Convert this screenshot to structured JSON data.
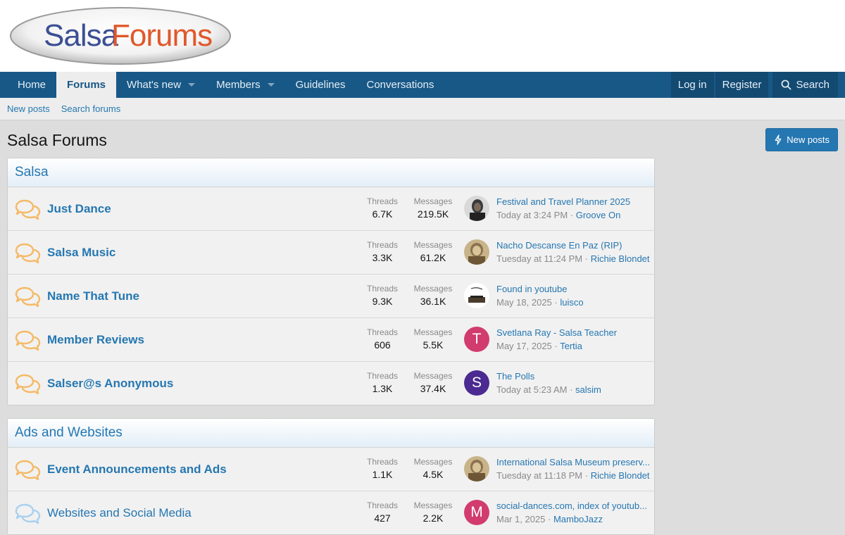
{
  "logo": {
    "part1": "Salsa",
    "part2": "Forums"
  },
  "nav": {
    "home": "Home",
    "forums": "Forums",
    "whats_new": "What's new",
    "members": "Members",
    "guidelines": "Guidelines",
    "conversations": "Conversations",
    "login": "Log in",
    "register": "Register",
    "search": "Search"
  },
  "subnav": {
    "new_posts": "New posts",
    "search_forums": "Search forums"
  },
  "page": {
    "title": "Salsa Forums",
    "new_posts_button": "New posts"
  },
  "labels": {
    "threads": "Threads",
    "messages": "Messages",
    "sep": " · "
  },
  "colors": {
    "accent": "#2577b1",
    "nav": "#185886",
    "icon_orange": "#f5b965",
    "icon_blue": "#a9d0ef"
  },
  "categories": [
    {
      "name": "Salsa",
      "forums": [
        {
          "title": "Just Dance",
          "threads": "6.7K",
          "messages": "219.5K",
          "latest_title": "Festival and Travel Planner 2025",
          "latest_time": "Today at 3:24 PM",
          "latest_user": "Groove On",
          "avatar": "photo-dark",
          "icon": "unread-chat-icon"
        },
        {
          "title": "Salsa Music",
          "threads": "3.3K",
          "messages": "61.2K",
          "latest_title": "Nacho Descanse En Paz (RIP)",
          "latest_time": "Tuesday at 11:24 PM",
          "latest_user": "Richie Blondet",
          "avatar": "photo-sepia",
          "icon": "unread-chat-icon"
        },
        {
          "title": "Name That Tune",
          "threads": "9.3K",
          "messages": "36.1K",
          "latest_title": "Found in youtube",
          "latest_time": "May 18, 2025",
          "latest_user": "luisco",
          "avatar": "photo-sketch",
          "icon": "unread-chat-icon"
        },
        {
          "title": "Member Reviews",
          "threads": "606",
          "messages": "5.5K",
          "latest_title": "Svetlana Ray - Salsa Teacher",
          "latest_time": "May 17, 2025",
          "latest_user": "Tertia",
          "avatar_letter": "T",
          "avatar_color": "#d13b6e",
          "icon": "unread-chat-icon"
        },
        {
          "title": "Salser@s Anonymous",
          "threads": "1.3K",
          "messages": "37.4K",
          "latest_title": "The Polls",
          "latest_time": "Today at 5:23 AM",
          "latest_user": "salsim",
          "avatar_letter": "S",
          "avatar_color": "#4b2a91",
          "icon": "unread-chat-icon"
        }
      ]
    },
    {
      "name": "Ads and Websites",
      "forums": [
        {
          "title": "Event Announcements and Ads",
          "threads": "1.1K",
          "messages": "4.5K",
          "latest_title": "International Salsa Museum preserv...",
          "latest_time": "Tuesday at 11:18 PM",
          "latest_user": "Richie Blondet",
          "avatar": "photo-sepia",
          "icon": "unread-chat-icon"
        },
        {
          "title": "Websites and Social Media",
          "threads": "427",
          "messages": "2.2K",
          "latest_title": "social-dances.com, index of youtub...",
          "latest_time": "Mar 1, 2025",
          "latest_user": "MamboJazz",
          "avatar_letter": "M",
          "avatar_color": "#d13b6e",
          "icon": "read-chat-icon"
        }
      ]
    }
  ]
}
